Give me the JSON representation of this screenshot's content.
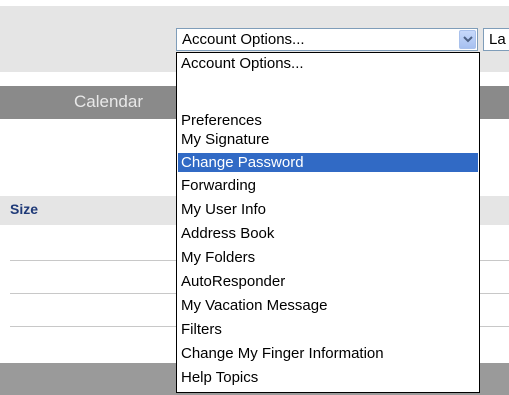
{
  "account_select": {
    "value": "Account Options...",
    "options": [
      "Account Options...",
      "",
      "Preferences",
      "My Signature",
      "Change Password",
      "Forwarding",
      "My User Info",
      "Address Book",
      "My Folders",
      "AutoResponder",
      "My Vacation Message",
      "Filters",
      "Change My Finger Information",
      "Help Topics"
    ],
    "highlighted": "Change Password"
  },
  "next_select": {
    "value": "La"
  },
  "nav": {
    "calendar_label": "Calendar"
  },
  "table": {
    "size_header": "Size"
  },
  "colors": {
    "highlight": "#316ac5",
    "header_text": "#1f3a78",
    "nav_bar": "#8a8a8a",
    "band": "#e5e5e5"
  }
}
